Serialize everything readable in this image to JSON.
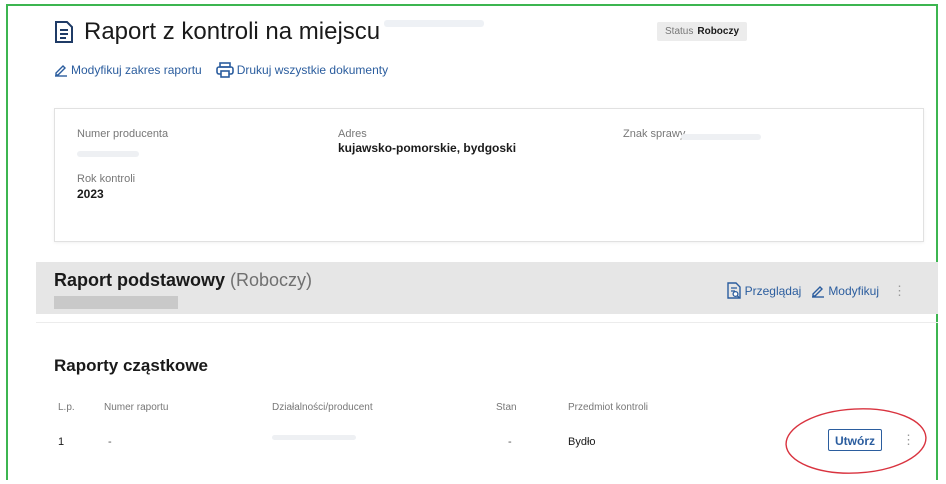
{
  "header": {
    "title": "Raport z kontroli na miejscu",
    "status_label": "Status",
    "status_value": "Roboczy"
  },
  "actions": {
    "modify_scope": "Modyfikuj zakres raportu",
    "print_all": "Drukuj wszystkie dokumenty"
  },
  "info": {
    "producer_number_label": "Numer producenta",
    "address_label": "Adres",
    "address_value": "kujawsko-pomorskie, bydgoski",
    "case_number_label": "Znak sprawy",
    "year_label": "Rok kontroli",
    "year_value": "2023"
  },
  "basic_report": {
    "title": "Raport podstawowy",
    "status": "(Roboczy)",
    "browse": "Przeglądaj",
    "modify": "Modyfikuj"
  },
  "partial_reports": {
    "title": "Raporty cząstkowe",
    "columns": [
      "L.p.",
      "Numer raportu",
      "Działalności/producent",
      "Stan",
      "Przedmiot kontroli"
    ],
    "rows": [
      {
        "lp": "1",
        "number": "-",
        "state": "-",
        "subject": "Bydło",
        "action": "Utwórz"
      }
    ]
  },
  "colors": {
    "accent": "#2b5d9e",
    "frame": "#3cb550",
    "highlight": "#d9333f"
  }
}
